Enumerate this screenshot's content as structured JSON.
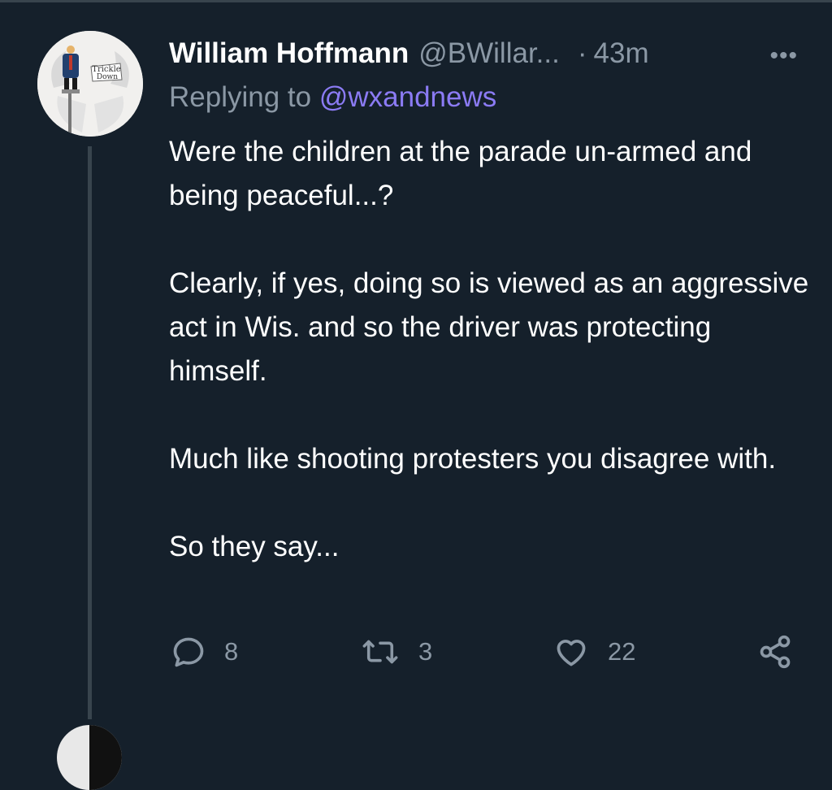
{
  "tweet": {
    "author_name": "William Hoffmann",
    "author_handle": "@BWillar...",
    "separator": "·",
    "time": "43m",
    "more_label": "•••",
    "replying_prefix": "Replying to",
    "replying_to": "@wxandnews",
    "paragraphs": [
      "Were the children at the parade un-armed and being peaceful...?",
      "Clearly, if yes, doing so is viewed as an aggressive act in Wis. and so the driver was protecting himself.",
      "Much like shooting protesters you disagree with.",
      "So they say..."
    ],
    "avatar_sign_text": [
      "Trickle",
      "Down"
    ]
  },
  "actions": {
    "reply": {
      "icon": "reply-icon",
      "count": "8"
    },
    "retweet": {
      "icon": "retweet-icon",
      "count": "3"
    },
    "like": {
      "icon": "heart-icon",
      "count": "22"
    },
    "share": {
      "icon": "share-icon"
    }
  },
  "colors": {
    "background": "#15202b",
    "text_primary": "#ffffff",
    "text_secondary": "#8b98a5",
    "mention_link": "#8b7bf4",
    "thread_line": "#38444d"
  }
}
